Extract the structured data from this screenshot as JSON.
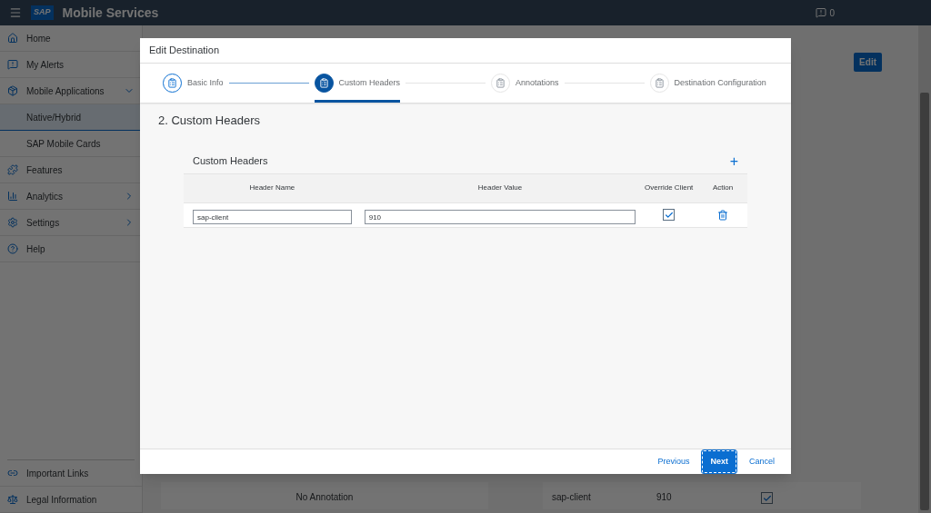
{
  "app_header": {
    "logo": "SAP",
    "title": "Mobile Services",
    "notifications": "0"
  },
  "sidebar": {
    "items": [
      {
        "label": "Home",
        "kind": "home",
        "selected": false
      },
      {
        "label": "My Alerts",
        "kind": "alert",
        "selected": false
      },
      {
        "label": "Mobile Applications",
        "kind": "cube",
        "selected": false,
        "expanded": true,
        "children": [
          {
            "label": "Native/Hybrid",
            "selected": true
          },
          {
            "label": "SAP Mobile Cards",
            "selected": false
          }
        ]
      },
      {
        "label": "Features",
        "kind": "features",
        "selected": false
      },
      {
        "label": "Analytics",
        "kind": "analytics",
        "selected": false,
        "expanded": false
      },
      {
        "label": "Settings",
        "kind": "settings",
        "selected": false,
        "expanded": false
      },
      {
        "label": "Help",
        "kind": "help",
        "selected": false
      }
    ],
    "footer_items": [
      {
        "label": "Important Links",
        "kind": "link"
      },
      {
        "label": "Legal Information",
        "kind": "legal"
      }
    ]
  },
  "page": {
    "edit_button": "Edit",
    "annotations_empty": "No Annotation",
    "headers_row": {
      "name": "sap-client",
      "value": "910",
      "override": true
    }
  },
  "dialog": {
    "title": "Edit Destination",
    "steps": [
      {
        "label": "Basic Info",
        "completed": true,
        "selected": false
      },
      {
        "label": "Custom Headers",
        "completed": false,
        "selected": true
      },
      {
        "label": "Annotations",
        "completed": false,
        "selected": false
      },
      {
        "label": "Destination Configuration",
        "completed": false,
        "selected": false
      }
    ],
    "section_title": "2. Custom Headers",
    "table": {
      "title": "Custom Headers",
      "add_button": "+",
      "columns": [
        "Header Name",
        "Header Value",
        "Override Client",
        "Action"
      ],
      "rows": [
        {
          "name": "sap-client",
          "value": "910",
          "override": true
        }
      ]
    },
    "buttons": [
      {
        "label": "Previous",
        "kind": "link"
      },
      {
        "label": "Next",
        "kind": "primary"
      },
      {
        "label": "Cancel",
        "kind": "link"
      }
    ]
  }
}
